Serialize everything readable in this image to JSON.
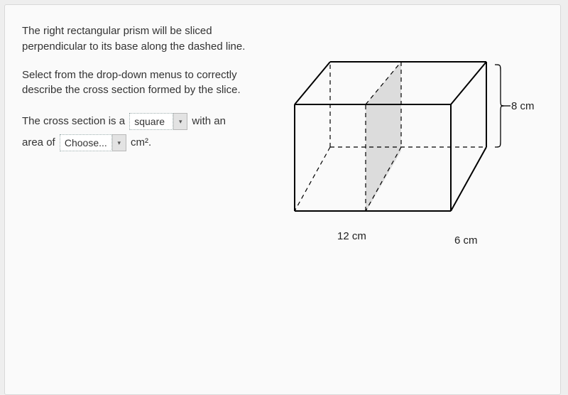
{
  "problem": {
    "paragraph1": "The right rectangular prism will be sliced perpendicular to its base along the dashed line.",
    "paragraph2": "Select from the drop-down menus to correctly describe the cross section formed by the slice.",
    "sentence_part1": "The cross section is a",
    "sentence_part2": "with an",
    "sentence_part3": "area of",
    "sentence_part4": "cm².",
    "dropdown1": {
      "selected": "square"
    },
    "dropdown2": {
      "selected": "Choose..."
    }
  },
  "figure": {
    "label_length": "12 cm",
    "label_width": "6 cm",
    "label_height": "8 cm"
  }
}
